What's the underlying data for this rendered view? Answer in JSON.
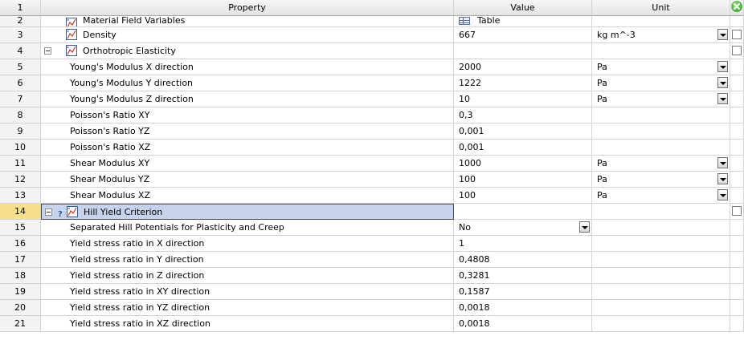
{
  "header": {
    "num": "1",
    "property": "Property",
    "value": "Value",
    "unit": "Unit"
  },
  "rows": [
    {
      "num": "2",
      "prop": "Material Field Variables",
      "value": "Table",
      "unit": "",
      "icon": "material-icon",
      "value_icon": "table-icon",
      "check": false
    },
    {
      "num": "3",
      "prop": "Density",
      "value": "667",
      "unit": "kg m^-3",
      "icon": "material-icon",
      "unit_dropdown": true,
      "check": true
    },
    {
      "num": "4",
      "prop": "Orthotropic Elasticity",
      "value": "",
      "unit": "",
      "icon": "material-icon",
      "expand": true,
      "check": true
    },
    {
      "num": "5",
      "prop": "Young's Modulus X direction",
      "value": "2000",
      "unit": "Pa",
      "unit_dropdown": true
    },
    {
      "num": "6",
      "prop": "Young's Modulus Y direction",
      "value": "1222",
      "unit": "Pa",
      "unit_dropdown": true
    },
    {
      "num": "7",
      "prop": "Young's Modulus Z direction",
      "value": "10",
      "unit": "Pa",
      "unit_dropdown": true
    },
    {
      "num": "8",
      "prop": "Poisson's Ratio XY",
      "value": "0,3",
      "unit": ""
    },
    {
      "num": "9",
      "prop": "Poisson's Ratio YZ",
      "value": "0,001",
      "unit": ""
    },
    {
      "num": "10",
      "prop": "Poisson's Ratio XZ",
      "value": "0,001",
      "unit": ""
    },
    {
      "num": "11",
      "prop": "Shear Modulus XY",
      "value": "1000",
      "unit": "Pa",
      "unit_dropdown": true
    },
    {
      "num": "12",
      "prop": "Shear Modulus YZ",
      "value": "100",
      "unit": "Pa",
      "unit_dropdown": true
    },
    {
      "num": "13",
      "prop": "Shear Modulus XZ",
      "value": "100",
      "unit": "Pa",
      "unit_dropdown": true
    },
    {
      "num": "14",
      "prop": "Hill Yield Criterion",
      "value": "",
      "unit": "",
      "icon": "material-icon",
      "expand": true,
      "question": true,
      "selected": true,
      "check": true
    },
    {
      "num": "15",
      "prop": "Separated Hill Potentials for Plasticity and Creep",
      "value": "No",
      "unit": "",
      "value_dropdown": true
    },
    {
      "num": "16",
      "prop": "Yield stress ratio in X direction",
      "value": "1",
      "unit": ""
    },
    {
      "num": "17",
      "prop": "Yield stress ratio in Y direction",
      "value": "0,4808",
      "unit": ""
    },
    {
      "num": "18",
      "prop": "Yield stress ratio in Z direction",
      "value": "0,3281",
      "unit": ""
    },
    {
      "num": "19",
      "prop": "Yield stress ratio in XY direction",
      "value": "0,1587",
      "unit": ""
    },
    {
      "num": "20",
      "prop": "Yield stress ratio in YZ direction",
      "value": "0,0018",
      "unit": ""
    },
    {
      "num": "21",
      "prop": "Yield stress ratio in XZ direction",
      "value": "0,0018",
      "unit": ""
    }
  ]
}
